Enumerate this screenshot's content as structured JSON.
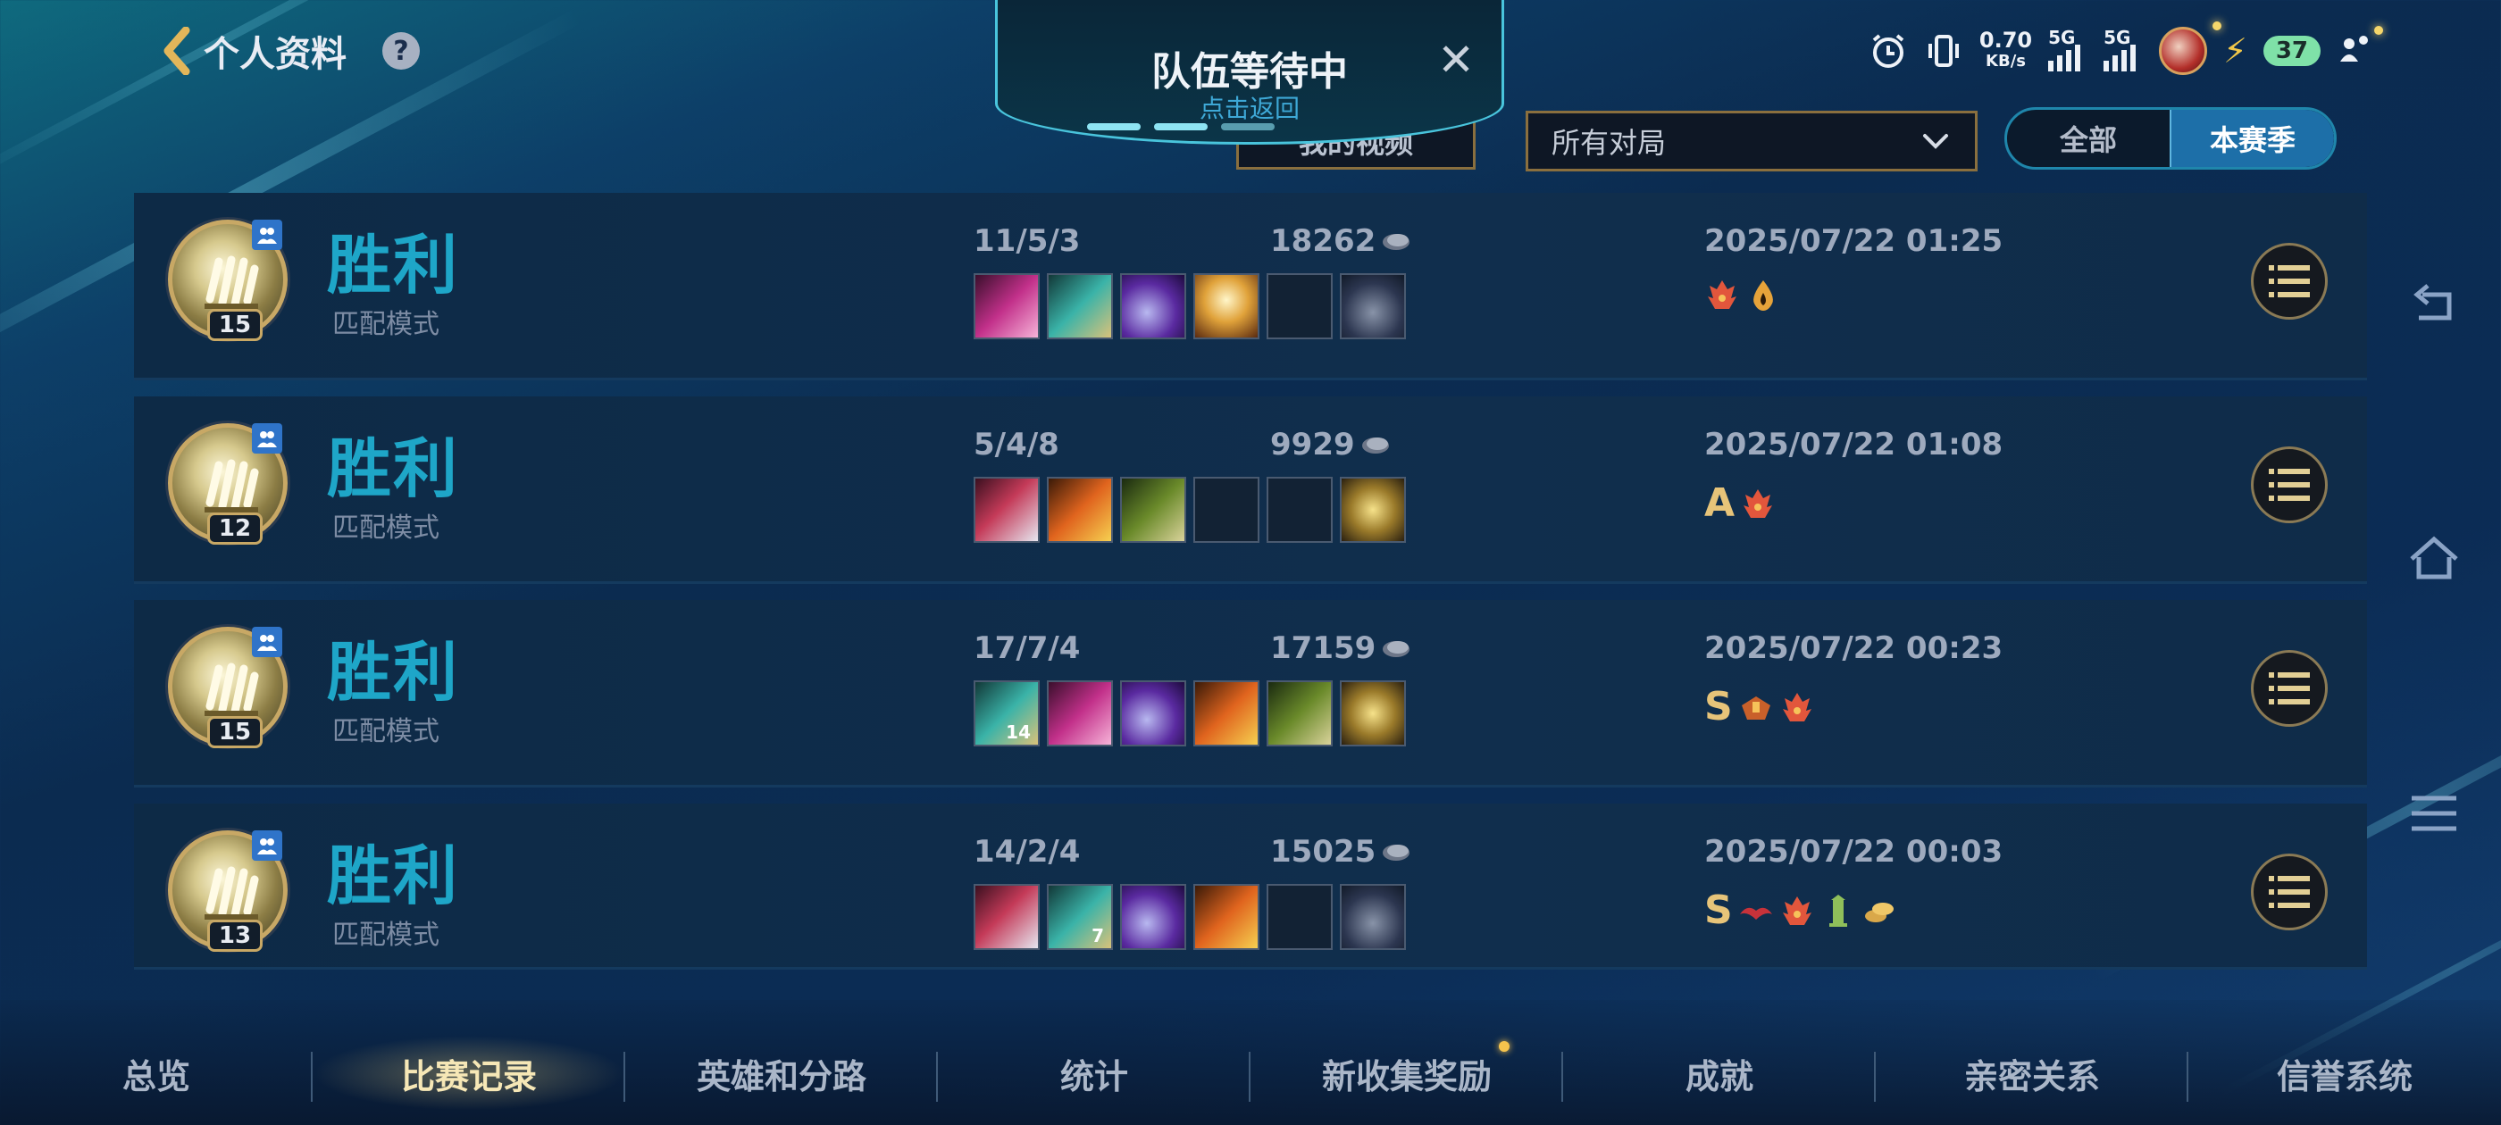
{
  "header": {
    "title": "个人资料",
    "help": "?"
  },
  "queue": {
    "title": "队伍等待中",
    "subtitle": "点击返回",
    "close": "✕"
  },
  "status_bar": {
    "speed_value": "0.70",
    "speed_unit": "KB/s",
    "network1": "5G",
    "network2": "5G",
    "battery": "37"
  },
  "filters": {
    "my_video": "我的视频",
    "dropdown_value": "所有对局",
    "seg_all": "全部",
    "seg_season": "本赛季"
  },
  "matches": [
    {
      "result": "胜利",
      "mode": "匹配模式",
      "level": "15",
      "kda": "11/5/3",
      "gold": "18262",
      "date": "2025/07/22 01:25",
      "grade": "",
      "items": [
        "blade-pink",
        "cannon-teal",
        "axe-purple",
        "angel-gold",
        "empty",
        "trinket-dark"
      ],
      "badges": [
        "flame-red",
        "drop-gold"
      ]
    },
    {
      "result": "胜利",
      "mode": "匹配模式",
      "level": "12",
      "kda": "5/4/8",
      "gold": "9929",
      "date": "2025/07/22 01:08",
      "grade": "A",
      "items": [
        "axe-red",
        "flame-orange",
        "sword-green",
        "empty",
        "empty",
        "boots-gold"
      ],
      "badges": [
        "flame-red"
      ]
    },
    {
      "result": "胜利",
      "mode": "匹配模式",
      "level": "15",
      "kda": "17/7/4",
      "gold": "17159",
      "date": "2025/07/22 00:23",
      "grade": "S",
      "items": [
        "cannon-teal-14",
        "blade-pink",
        "axe-purple",
        "flame-orange",
        "sword-green",
        "boots-gold"
      ],
      "badges": [
        "beast-orange",
        "flame-red"
      ]
    },
    {
      "result": "胜利",
      "mode": "匹配模式",
      "level": "13",
      "kda": "14/2/4",
      "gold": "15025",
      "date": "2025/07/22 00:03",
      "grade": "S",
      "items": [
        "axe-red",
        "cannon-teal-7",
        "axe-purple",
        "flame-orange",
        "empty",
        "trinket-dark"
      ],
      "badges": [
        "wing-red",
        "flame-red",
        "tower-green",
        "coins-gold"
      ]
    }
  ],
  "tabs": [
    "总览",
    "比赛记录",
    "英雄和分路",
    "统计",
    "新收集奖励",
    "成就",
    "亲密关系",
    "信誉系统"
  ],
  "active_tab": "比赛记录",
  "colors": {
    "accent_win": "#1ea6c8",
    "gold_text": "#e7c479",
    "active_tab": "#f6e7b6"
  }
}
